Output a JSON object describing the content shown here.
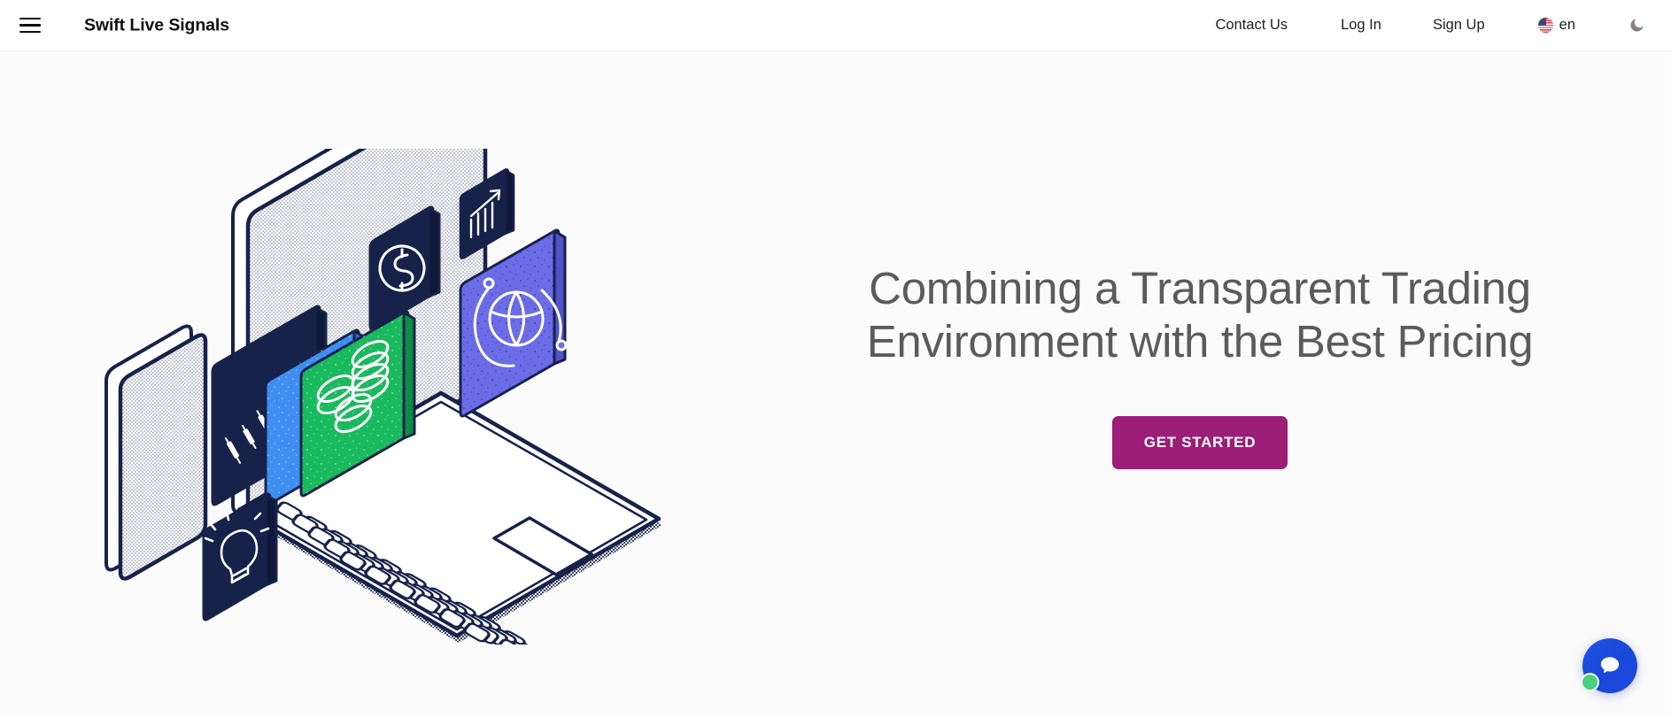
{
  "header": {
    "menu_icon": "hamburger-menu-icon",
    "brand": "Swift Live Signals",
    "nav": {
      "contact": "Contact Us",
      "login": "Log In",
      "signup": "Sign Up"
    },
    "language": {
      "flag_icon": "us-flag-icon",
      "code": "en"
    },
    "theme_toggle_icon": "moon-icon"
  },
  "hero": {
    "title": "Combining a Transparent Trading Environment with the Best Pricing",
    "cta_label": "GET STARTED",
    "illustration": {
      "name": "isometric-trading-devices-illustration",
      "elements": [
        "laptop",
        "smartphone",
        "candlestick-chart-card",
        "coins-card",
        "blue-card",
        "dollar-coin-card",
        "bar-chart-card",
        "globe-card",
        "lightbulb-card"
      ]
    }
  },
  "chat": {
    "widget_icon": "chat-bubble-icon",
    "status": "online"
  },
  "colors": {
    "cta": "#9c1e76",
    "headline": "#5b5b5b",
    "page_bg": "#fbfbfb",
    "header_bg": "#ffffff",
    "ink": "#16224a",
    "chat_blue": "#1e53e4",
    "status_green": "#4ad07e",
    "card_green": "#19b95e",
    "card_blue": "#3d8ef0",
    "card_indigo": "#6c6ce8"
  }
}
